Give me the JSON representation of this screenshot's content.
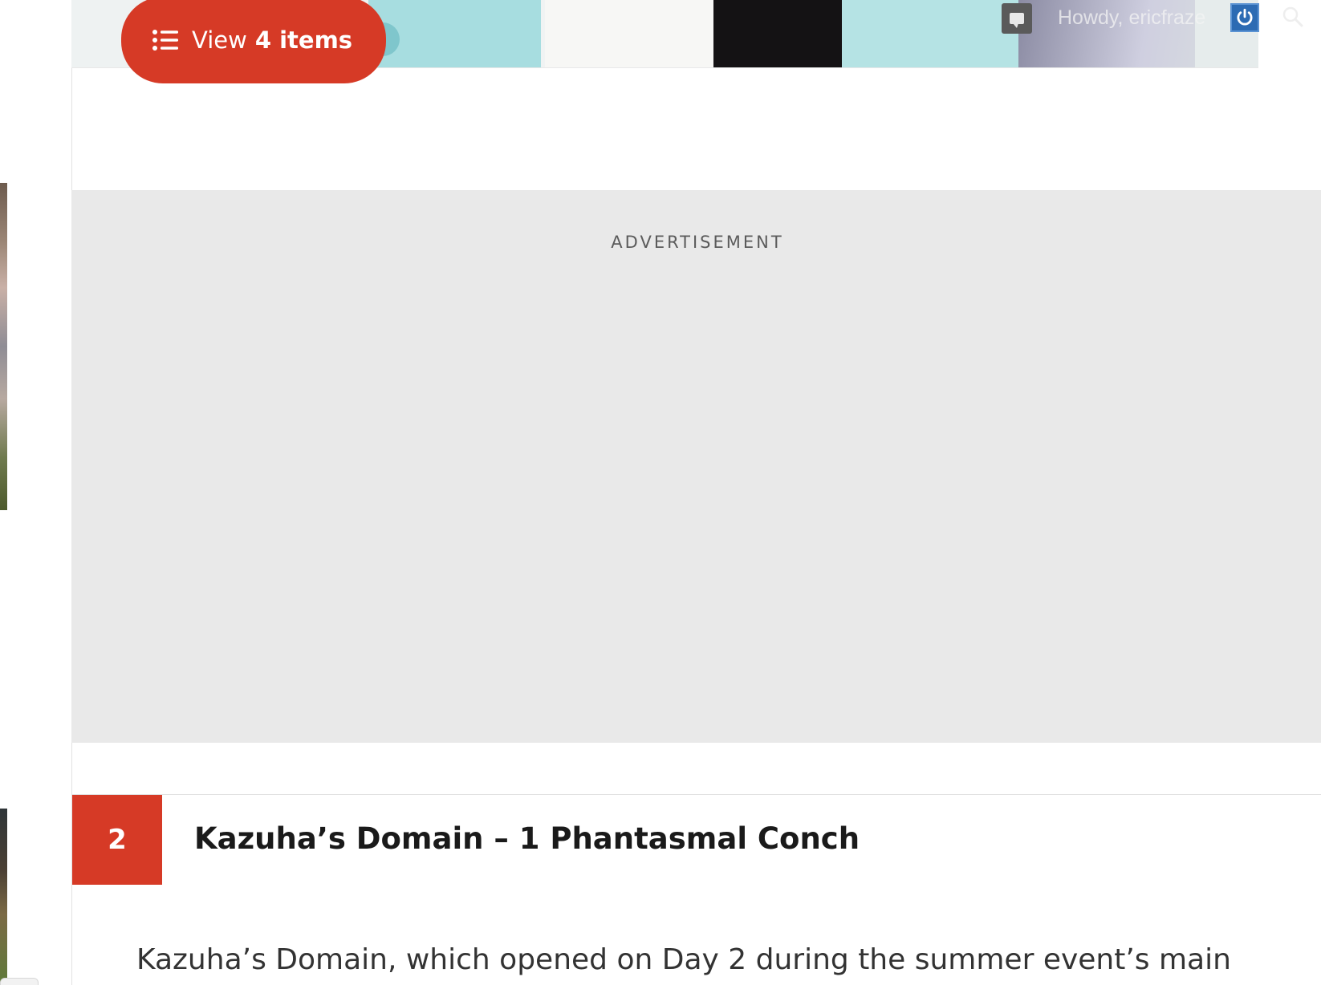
{
  "toc_button": {
    "view_label": "View",
    "count_label": "4 items"
  },
  "admin_bar": {
    "howdy_text": "Howdy, ericfraze",
    "icons": [
      "comment-icon",
      "power-icon",
      "search-icon"
    ]
  },
  "ad": {
    "label": "ADVERTISEMENT"
  },
  "list_item": {
    "number": "2",
    "title": "Kazuha’s Domain – 1 Phantasmal Conch",
    "body_start": "Kazuha’s Domain, which opened on Day 2 during the summer event’s main"
  },
  "colors": {
    "accent": "#d63a26",
    "ad_background": "#e9e9e9",
    "admin_power": "#2c6bb3"
  }
}
